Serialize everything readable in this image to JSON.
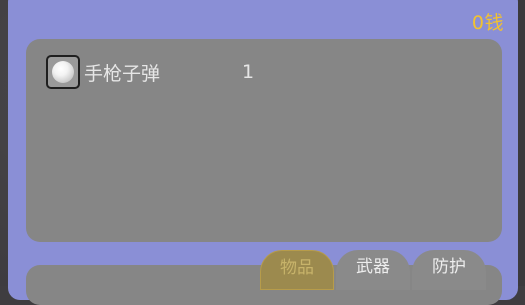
{
  "header": {
    "money_label": "0钱"
  },
  "inventory": {
    "items": [
      {
        "name": "手枪子弹",
        "count": "1",
        "icon": "bullet-icon"
      }
    ]
  },
  "tabs": [
    {
      "label": "物品",
      "active": true
    },
    {
      "label": "武器",
      "active": false
    },
    {
      "label": "防护",
      "active": false
    }
  ],
  "colors": {
    "window_bg": "#8a8fd6",
    "panel_bg": "#868686",
    "money_text": "#f2c230",
    "active_tab": "#9c8a4e"
  }
}
